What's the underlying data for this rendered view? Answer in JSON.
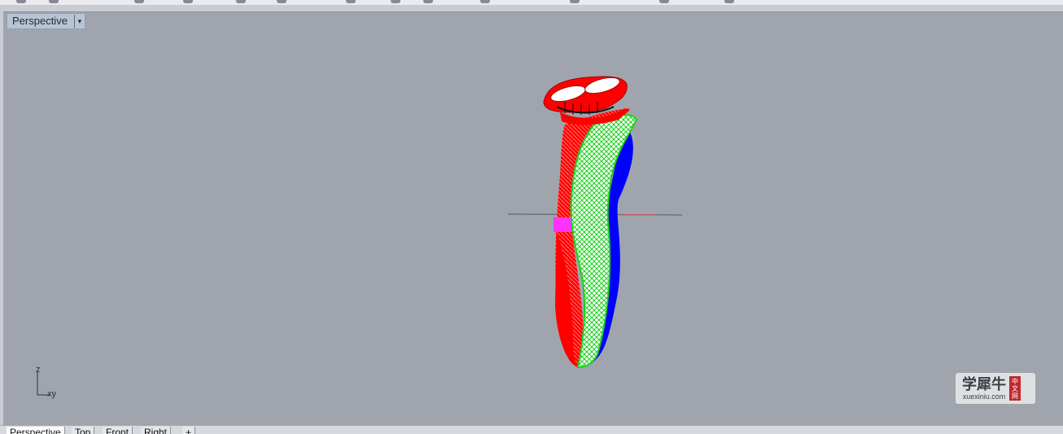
{
  "viewport": {
    "title": "Perspective",
    "menu_caret": "▾",
    "axis_labels": {
      "z": "z",
      "xy": "xy"
    }
  },
  "watermark": {
    "chinese": "学犀牛",
    "url": "xuexiniu.com",
    "badge": [
      "中",
      "文",
      "网"
    ]
  },
  "tabs": [
    {
      "label": "Perspective",
      "active": true
    },
    {
      "label": "Top",
      "active": false
    },
    {
      "label": "Front",
      "active": false
    },
    {
      "label": "Right",
      "active": false
    },
    {
      "label": "+",
      "active": false
    }
  ],
  "colors": {
    "viewport_bg": "#a0a5ad",
    "red_surface": "#ff0000",
    "green_surface": "#22dd22",
    "blue_surface": "#0000ff",
    "magenta_band": "#ff33ff"
  },
  "icons": [
    "dropdown-caret-icon",
    "axis-widget-icon",
    "watermark-logo"
  ]
}
